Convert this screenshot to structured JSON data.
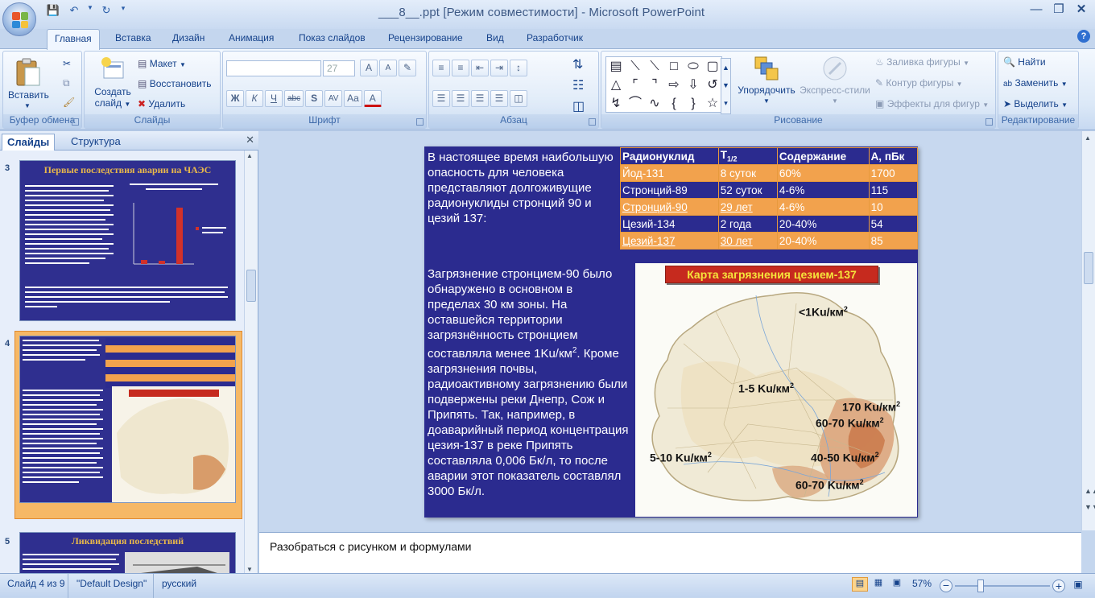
{
  "window": {
    "title": "___8__.ppt [Режим совместимости] - Microsoft PowerPoint"
  },
  "tabs": [
    "Главная",
    "Вставка",
    "Дизайн",
    "Анимация",
    "Показ слайдов",
    "Рецензирование",
    "Вид",
    "Разработчик"
  ],
  "ribbon": {
    "clipboard": {
      "paste": "Вставить",
      "title": "Буфер обмена"
    },
    "slides": {
      "new_slide_1": "Создать",
      "new_slide_2": "слайд",
      "layout": "Макет",
      "reset": "Восстановить",
      "delete": "Удалить",
      "title": "Слайды"
    },
    "font": {
      "size": "27",
      "title": "Шрифт",
      "bold": "Ж",
      "italic": "К",
      "underline": "Ч",
      "strike": "abc",
      "shadow": "S",
      "spacing": "AV",
      "case": "Aa",
      "color": "A",
      "grow": "A",
      "shrink": "A"
    },
    "paragraph": {
      "title": "Абзац"
    },
    "drawing": {
      "arrange": "Упорядочить",
      "quick_styles": "Экспресс-стили",
      "fill": "Заливка фигуры",
      "outline": "Контур фигуры",
      "effects": "Эффекты для фигур",
      "title": "Рисование"
    },
    "editing": {
      "find": "Найти",
      "replace": "Заменить",
      "select": "Выделить",
      "title": "Редактирование"
    }
  },
  "left_pane": {
    "tab_slides": "Слайды",
    "tab_outline": "Структура",
    "thumbs": [
      {
        "num": "3",
        "title": "Первые последствия аварии на ЧАЭС"
      },
      {
        "num": "4"
      },
      {
        "num": "5",
        "title": "Ликвидация последствий"
      }
    ]
  },
  "slide": {
    "text1": "В настоящее время наибольшую опасность для человека представляют долгоживущие радионуклиды стронций 90 и цезий 137:",
    "text2_a": "Загрязнение стронцием-90 было обнаружено в основном в пределах 30 км зоны. На оставшейся территории загрязнённость стронцием составляла менее 1Ku/км",
    "text2_sup": "2",
    "text2_b": ". Кроме загрязнения почвы, радиоактивному загрязнению были подвержены реки Днепр, Сож и Припять. Так, например, в доаварийный период концентрация цезия-137 в реке Припять составляла 0,006 Бк/л, то после аварии этот показатель составлял 3000 Бк/л.",
    "table": {
      "headers": [
        "Радионуклид",
        "T",
        "1/2",
        "Содержание",
        "А, пБк"
      ],
      "rows": [
        [
          "Йод-131",
          "8 суток",
          "60%",
          "1700"
        ],
        [
          "Стронций-89",
          "52 суток",
          "4-6%",
          "115"
        ],
        [
          "Стронций-90",
          "29 лет",
          "4-6%",
          "10"
        ],
        [
          "Цезий-134",
          "2 года",
          "20-40%",
          "54"
        ],
        [
          "Цезий-137",
          "30 лет",
          "20-40%",
          "85"
        ]
      ]
    },
    "map": {
      "title": "Карта загрязнения цезием-137",
      "labels": [
        {
          "t": "<1Ku/км",
          "s": "2"
        },
        {
          "t": "1-5 Ku/км",
          "s": "2"
        },
        {
          "t": "170 Ku/км",
          "s": "2"
        },
        {
          "t": "60-70 Ku/км",
          "s": "2"
        },
        {
          "t": "5-10 Ku/км",
          "s": "2"
        },
        {
          "t": "40-50 Ku/км",
          "s": "2"
        },
        {
          "t": "60-70 Ku/км",
          "s": "2"
        }
      ]
    }
  },
  "notes": "Разобраться с рисунком и формулами",
  "status": {
    "slide": "Слайд 4 из 9",
    "design": "\"Default Design\"",
    "lang": "русский",
    "zoom": "57%"
  }
}
